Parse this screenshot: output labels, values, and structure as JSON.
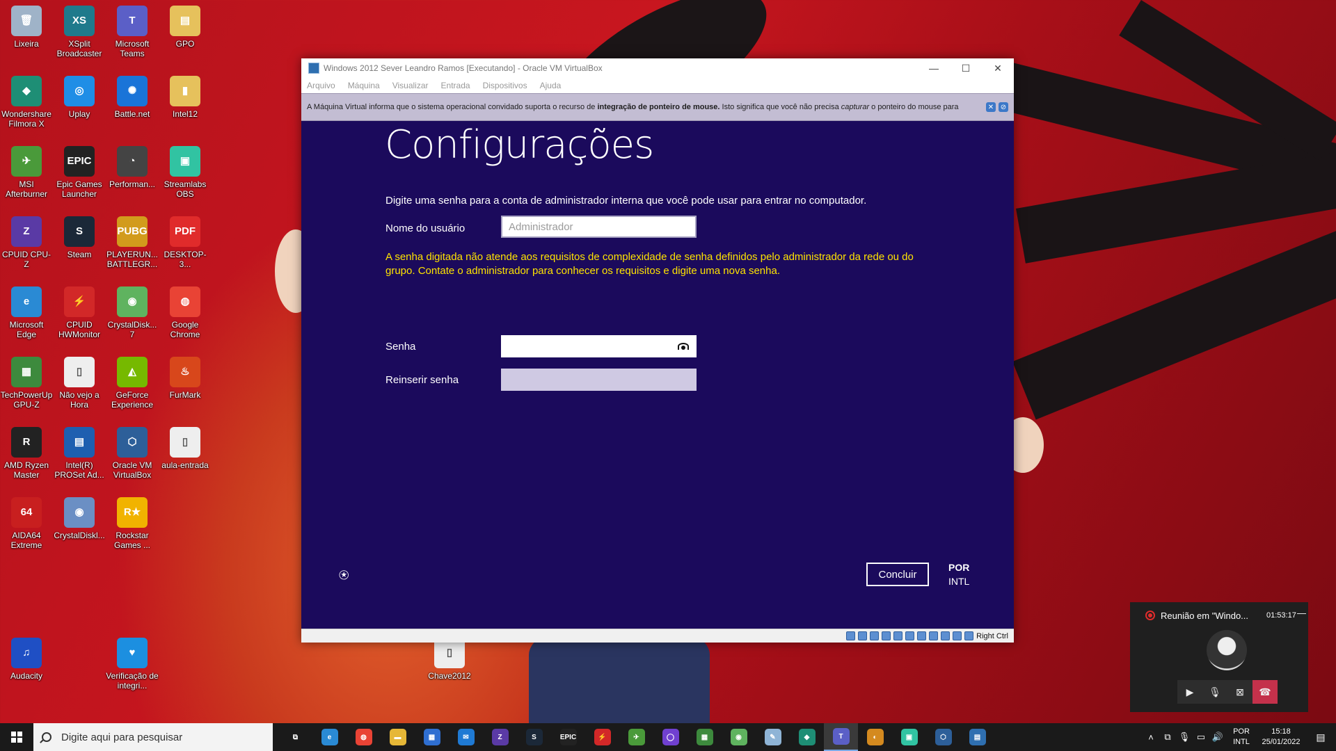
{
  "desktop": {
    "icons": [
      {
        "label": "Lixeira",
        "glyph": "🗑",
        "color": "#9fb3c8"
      },
      {
        "label": "XSplit Broadcaster",
        "glyph": "XS",
        "color": "#1f7a8c"
      },
      {
        "label": "Microsoft Teams",
        "glyph": "T",
        "color": "#5b5fc7"
      },
      {
        "label": "GPO",
        "glyph": "▤",
        "color": "#e6c15c"
      },
      {
        "label": "Wondershare Filmora X",
        "glyph": "◆",
        "color": "#1e8e75"
      },
      {
        "label": "Uplay",
        "glyph": "◎",
        "color": "#1f8ee6"
      },
      {
        "label": "Battle.net",
        "glyph": "✺",
        "color": "#1a74d8"
      },
      {
        "label": "Intel12",
        "glyph": "▮",
        "color": "#e6c15c"
      },
      {
        "label": "MSI Afterburner",
        "glyph": "✈",
        "color": "#4a9a3a"
      },
      {
        "label": "Epic Games Launcher",
        "glyph": "EPIC",
        "color": "#222222"
      },
      {
        "label": "Performan...",
        "glyph": "◔",
        "color": "#444444"
      },
      {
        "label": "Streamlabs OBS",
        "glyph": "▣",
        "color": "#31c3a2"
      },
      {
        "label": "CPUID CPU-Z",
        "glyph": "Z",
        "color": "#5a3aa5"
      },
      {
        "label": "Steam",
        "glyph": "S",
        "color": "#1b2838"
      },
      {
        "label": "PLAYERUN... BATTLEGR...",
        "glyph": "PUBG",
        "color": "#d29b1c"
      },
      {
        "label": "DESKTOP-3...",
        "glyph": "PDF",
        "color": "#e02b2b"
      },
      {
        "label": "Microsoft Edge",
        "glyph": "e",
        "color": "#2a8ad4"
      },
      {
        "label": "CPUID HWMonitor",
        "glyph": "⚡",
        "color": "#d22828"
      },
      {
        "label": "CrystalDisk... 7",
        "glyph": "◉",
        "color": "#5fb35f"
      },
      {
        "label": "Google Chrome",
        "glyph": "◍",
        "color": "#e94335"
      },
      {
        "label": "TechPowerUp GPU-Z",
        "glyph": "▦",
        "color": "#3d8a3d"
      },
      {
        "label": "Não vejo a Hora",
        "glyph": "▯",
        "color": "#eeeeee"
      },
      {
        "label": "GeForce Experience",
        "glyph": "◭",
        "color": "#76b900"
      },
      {
        "label": "FurMark",
        "glyph": "♨",
        "color": "#d8471b"
      },
      {
        "label": "AMD Ryzen Master",
        "glyph": "R",
        "color": "#222222"
      },
      {
        "label": "Intel(R) PROSet Ad...",
        "glyph": "▤",
        "color": "#1e5fb0"
      },
      {
        "label": "Oracle VM VirtualBox",
        "glyph": "⬡",
        "color": "#2d5f99"
      },
      {
        "label": "aula-entrada",
        "glyph": "▯",
        "color": "#eeeeee"
      },
      {
        "label": "AIDA64 Extreme",
        "glyph": "64",
        "color": "#c81f1f"
      },
      {
        "label": "CrystalDiskl...",
        "glyph": "◉",
        "color": "#6b8fc4"
      },
      {
        "label": "Rockstar Games ...",
        "glyph": "R★",
        "color": "#f1b300"
      },
      {
        "label": "Audacity",
        "glyph": "♫",
        "color": "#1f4fc4"
      },
      {
        "label": "Verificação de integri...",
        "glyph": "♥",
        "color": "#1c8fe0"
      },
      {
        "label": "Chave2012",
        "glyph": "▯",
        "color": "#eeeeee"
      }
    ]
  },
  "vbox": {
    "title": "Windows 2012 Sever Leandro Ramos [Executando] - Oracle VM VirtualBox",
    "menu": [
      "Arquivo",
      "Máquina",
      "Visualizar",
      "Entrada",
      "Dispositivos",
      "Ajuda"
    ],
    "notice_pre": "A Máquina Virtual informa que o sistema operacional convidado suporta o recurso de ",
    "notice_bold": "integração de ponteiro de mouse.",
    "notice_mid": " Isto significa que você não precisa ",
    "notice_em": "capturar",
    "notice_post": " o ponteiro do mouse para",
    "host_key": "Right Ctrl"
  },
  "setup": {
    "heading": "Configurações",
    "intro": "Digite uma senha para a conta de administrador interna que você pode usar para entrar no computador.",
    "username_label": "Nome do usuário",
    "username_value": "Administrador",
    "error": "A senha digitada não atende aos requisitos de complexidade de senha definidos pelo administrador da rede ou do grupo. Contate o administrador para conhecer os requisitos e digite uma nova senha.",
    "password_label": "Senha",
    "repassword_label": "Reinserir senha",
    "finish_button": "Concluir",
    "lang_line1": "POR",
    "lang_line2": "INTL"
  },
  "meeting": {
    "title": "Reunião em \"Windo...",
    "time": "01:53:17"
  },
  "taskbar": {
    "search_placeholder": "Digite aqui para pesquisar",
    "apps": [
      {
        "name": "task-view",
        "glyph": "⧉",
        "color": "transparent"
      },
      {
        "name": "edge",
        "glyph": "e",
        "color": "#2a8ad4"
      },
      {
        "name": "chrome",
        "glyph": "◍",
        "color": "#e94335"
      },
      {
        "name": "file-explorer",
        "glyph": "▬",
        "color": "#e6b737"
      },
      {
        "name": "store",
        "glyph": "▦",
        "color": "#2f6fd1"
      },
      {
        "name": "mail",
        "glyph": "✉",
        "color": "#1f7ad4"
      },
      {
        "name": "cpu-z",
        "glyph": "Z",
        "color": "#5a3aa5"
      },
      {
        "name": "steam",
        "glyph": "S",
        "color": "#1b2838"
      },
      {
        "name": "epic",
        "glyph": "EPIC",
        "color": "#222222"
      },
      {
        "name": "hwmonitor",
        "glyph": "⚡",
        "color": "#d22828"
      },
      {
        "name": "msi-afterburner",
        "glyph": "✈",
        "color": "#4a9a3a"
      },
      {
        "name": "obs",
        "glyph": "◯",
        "color": "#7040d0"
      },
      {
        "name": "gpu-z",
        "glyph": "▦",
        "color": "#3d8a3d"
      },
      {
        "name": "crystaldisk",
        "glyph": "◉",
        "color": "#5fb35f"
      },
      {
        "name": "notepad",
        "glyph": "✎",
        "color": "#8fb4d6"
      },
      {
        "name": "filmora",
        "glyph": "◆",
        "color": "#1e8e75"
      },
      {
        "name": "teams",
        "glyph": "T",
        "color": "#5b5fc7"
      },
      {
        "name": "overwolf",
        "glyph": "◐",
        "color": "#d48a1f"
      },
      {
        "name": "streamlabs",
        "glyph": "▣",
        "color": "#31c3a2"
      },
      {
        "name": "virtualbox",
        "glyph": "⬡",
        "color": "#2d5f99"
      },
      {
        "name": "vm-window",
        "glyph": "▤",
        "color": "#2f6fb0"
      }
    ],
    "tray_lang1": "POR",
    "tray_lang2": "INTL",
    "clock_time": "15:18",
    "clock_date": "25/01/2022"
  }
}
